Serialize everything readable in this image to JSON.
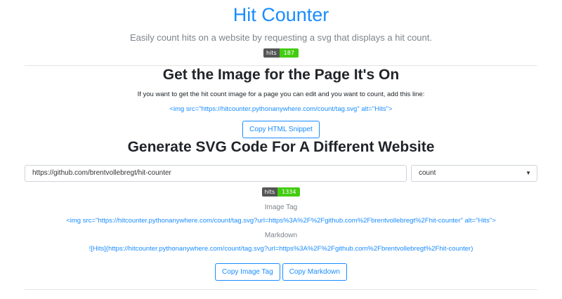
{
  "header": {
    "title": "Hit Counter",
    "subtitle": "Easily count hits on a website by requesting a svg that displays a hit count.",
    "badge": {
      "left": "hits",
      "right": "187"
    }
  },
  "section_page": {
    "heading": "Get the Image for the Page It's On",
    "description": "If you want to get the hit count image for a page you can edit and you want to count, add this line:",
    "snippet": "<img src=\"https://hitcounter.pythonanywhere.com/count/tag.svg\" alt=\"Hits\">",
    "copy_button": "Copy HTML Snippet"
  },
  "section_generate": {
    "heading": "Generate SVG Code For A Different Website",
    "url_value": "https://github.com/brentvollebregt/hit-counter",
    "select_value": "count",
    "badge": {
      "left": "hits",
      "right": "1334"
    },
    "image_tag_label": "Image Tag",
    "image_tag_code": "<img src=\"https://hitcounter.pythonanywhere.com/count/tag.svg?url=https%3A%2F%2Fgithub.com%2Fbrentvollebregt%2Fhit-counter\" alt=\"Hits\">",
    "markdown_label": "Markdown",
    "markdown_code": "![Hits](https://hitcounter.pythonanywhere.com/count/tag.svg?url=https%3A%2F%2Fgithub.com%2Fbrentvollebregt%2Fhit-counter)",
    "copy_image_tag_button": "Copy Image Tag",
    "copy_markdown_button": "Copy Markdown"
  },
  "colors": {
    "accent": "#1a8cff",
    "badge_left": "#555555",
    "badge_right": "#44cc11"
  }
}
